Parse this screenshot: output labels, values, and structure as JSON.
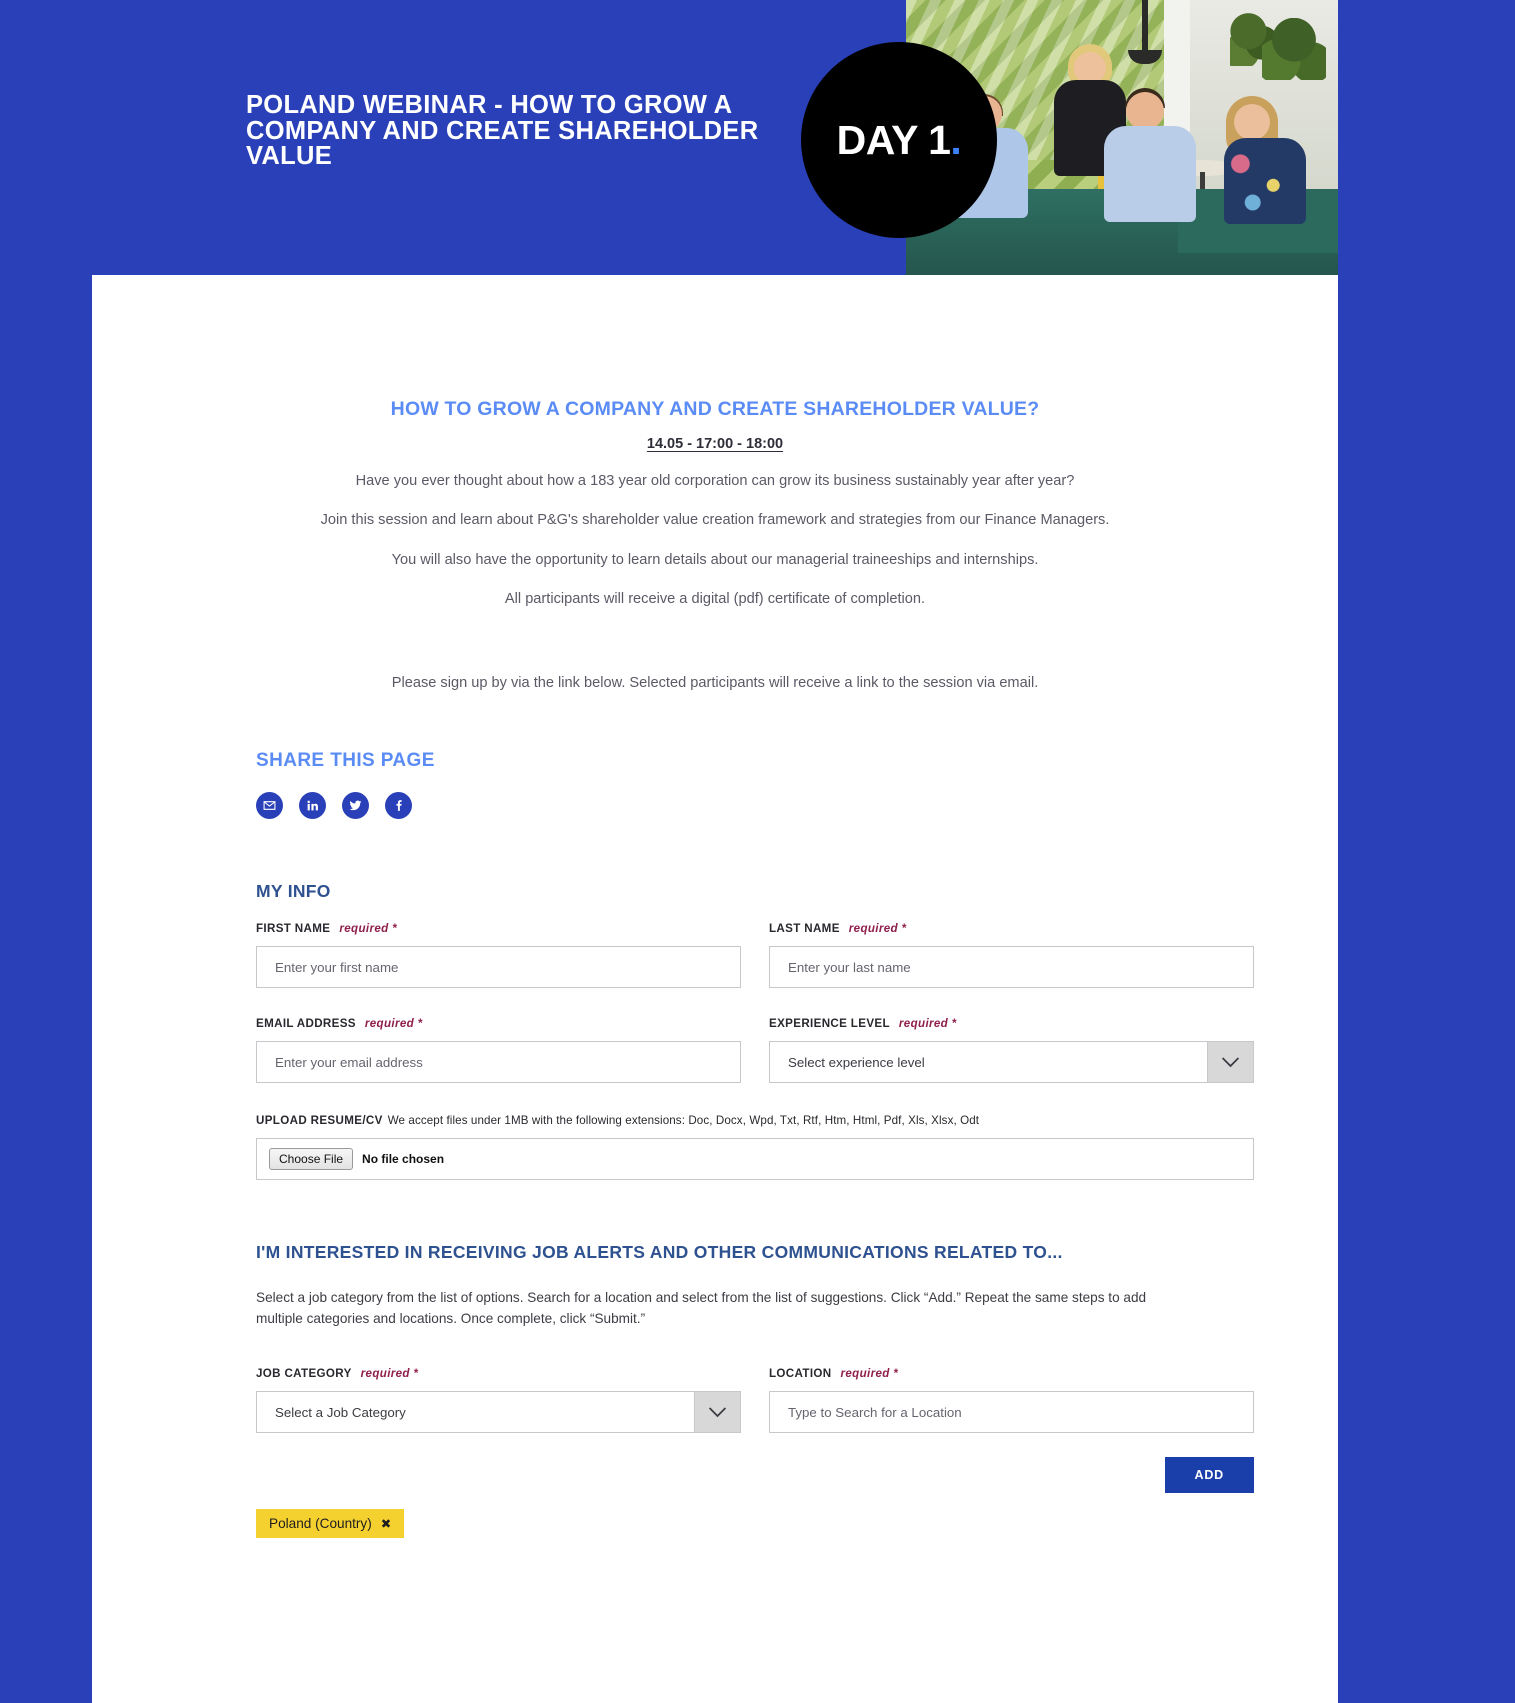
{
  "hero": {
    "title": "POLAND WEBINAR - HOW TO GROW A COMPANY AND CREATE SHAREHOLDER VALUE",
    "badge_text": "DAY 1",
    "badge_dot": ".",
    "background_color": "#2a40b8",
    "badge_color": "#000000",
    "badge_dot_color": "#3b82f6"
  },
  "session": {
    "title": "HOW TO GROW A COMPANY AND CREATE SHAREHOLDER VALUE?",
    "date": "14.05 - 17:00 - 18:00",
    "title_color": "#5b8cf5",
    "paragraphs": [
      "Have you ever thought about how a 183 year old corporation can grow its business sustainably year after year?",
      "Join this session and learn about P&G's shareholder value creation framework and strategies from our Finance Managers.",
      "You will also have the opportunity to learn details about our managerial traineeships and internships.",
      "All participants will receive a digital (pdf) certificate of completion."
    ],
    "signup_note": "Please sign up by via the link below. Selected participants will receive a link to the session via email."
  },
  "share": {
    "title": "SHARE THIS PAGE",
    "icon_color": "#2a40b8",
    "items": [
      {
        "name": "email-icon",
        "label": "Email"
      },
      {
        "name": "linkedin-icon",
        "label": "LinkedIn"
      },
      {
        "name": "twitter-icon",
        "label": "Twitter"
      },
      {
        "name": "facebook-icon",
        "label": "Facebook"
      }
    ]
  },
  "my_info": {
    "section_title": "MY INFO",
    "required_text": "required *",
    "fields": {
      "first_name": {
        "label": "FIRST NAME",
        "placeholder": "Enter your first name",
        "value": ""
      },
      "last_name": {
        "label": "LAST NAME",
        "placeholder": "Enter your last name",
        "value": ""
      },
      "email": {
        "label": "EMAIL ADDRESS",
        "placeholder": "Enter your email address",
        "value": ""
      },
      "experience": {
        "label": "EXPERIENCE LEVEL",
        "placeholder": "Select experience level",
        "value": "Select experience level"
      }
    },
    "upload": {
      "label": "UPLOAD RESUME/CV",
      "hint": "We accept files under 1MB with the following extensions: Doc, Docx, Wpd, Txt, Rtf, Htm, Html, Pdf, Xls, Xlsx, Odt",
      "button_label": "Choose File",
      "file_status": "No file chosen"
    }
  },
  "job_alerts": {
    "section_title": "I'M INTERESTED IN RECEIVING JOB ALERTS AND OTHER COMMUNICATIONS RELATED TO...",
    "description": "Select a job category from the list of options. Search for a location and select from the list of suggestions. Click “Add.” Repeat the same steps to add multiple categories and locations. Once complete, click “Submit.”",
    "required_text": "required *",
    "job_category": {
      "label": "JOB CATEGORY",
      "placeholder": "Select a Job Category",
      "value": "Select a Job Category"
    },
    "location": {
      "label": "LOCATION",
      "placeholder": "Type to Search for a Location",
      "value": ""
    },
    "add_button": "ADD",
    "add_button_color": "#1b3faa",
    "tags": [
      {
        "label": "Poland (Country)",
        "remove": "✖",
        "color": "#f5d130"
      }
    ]
  }
}
